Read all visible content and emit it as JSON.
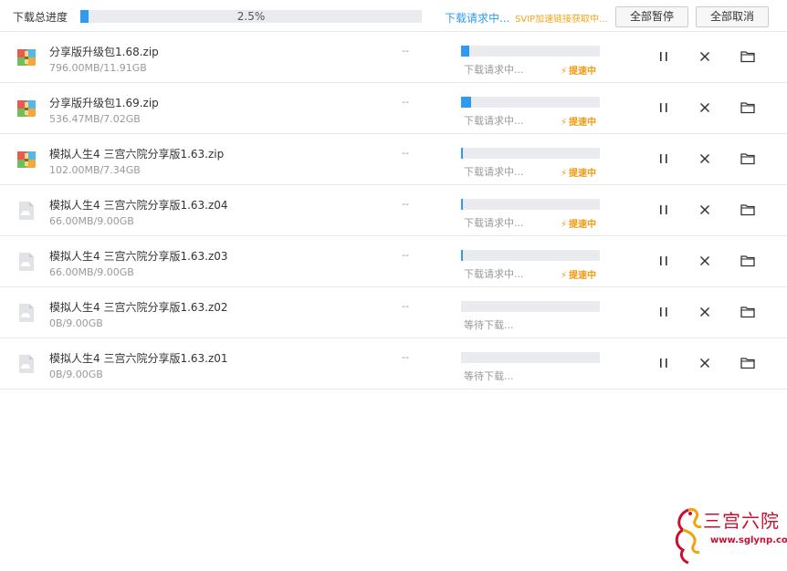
{
  "header": {
    "overall_label": "下载总进度",
    "overall_percent_text": "2.5%",
    "overall_progress": 0.025,
    "status": "下载请求中...",
    "svip_hint": "SVIP加速链接获取中...",
    "pause_all_label": "全部暂停",
    "cancel_all_label": "全部取消"
  },
  "colors": {
    "accent": "#2f9bf0",
    "boost": "#f39a12",
    "track": "#e9ebef"
  },
  "downloads": [
    {
      "name": "分享版升级包1.68.zip",
      "size": "796.00MB/11.91GB",
      "speed": "--",
      "progress": 0.06,
      "status": "下载请求中...",
      "boost": "提速中",
      "icon": "zip-archive-icon"
    },
    {
      "name": "分享版升级包1.69.zip",
      "size": "536.47MB/7.02GB",
      "speed": "--",
      "progress": 0.075,
      "status": "下载请求中...",
      "boost": "提速中",
      "icon": "zip-archive-icon"
    },
    {
      "name": "模拟人生4 三宫六院分享版1.63.zip",
      "size": "102.00MB/7.34GB",
      "speed": "--",
      "progress": 0.014,
      "status": "下载请求中...",
      "boost": "提速中",
      "icon": "zip-archive-icon"
    },
    {
      "name": "模拟人生4 三宫六院分享版1.63.z04",
      "size": "66.00MB/9.00GB",
      "speed": "--",
      "progress": 0.007,
      "status": "下载请求中...",
      "boost": "提速中",
      "icon": "cloud-file-icon"
    },
    {
      "name": "模拟人生4 三宫六院分享版1.63.z03",
      "size": "66.00MB/9.00GB",
      "speed": "--",
      "progress": 0.007,
      "status": "下载请求中...",
      "boost": "提速中",
      "icon": "cloud-file-icon"
    },
    {
      "name": "模拟人生4 三宫六院分享版1.63.z02",
      "size": "0B/9.00GB",
      "speed": "--",
      "progress": 0,
      "status": "等待下载...",
      "boost": "",
      "icon": "cloud-file-icon"
    },
    {
      "name": "模拟人生4 三宫六院分享版1.63.z01",
      "size": "0B/9.00GB",
      "speed": "--",
      "progress": 0,
      "status": "等待下载...",
      "boost": "",
      "icon": "cloud-file-icon"
    }
  ],
  "watermark": {
    "title": "三宫六院",
    "url": "www.sglynp.com"
  }
}
